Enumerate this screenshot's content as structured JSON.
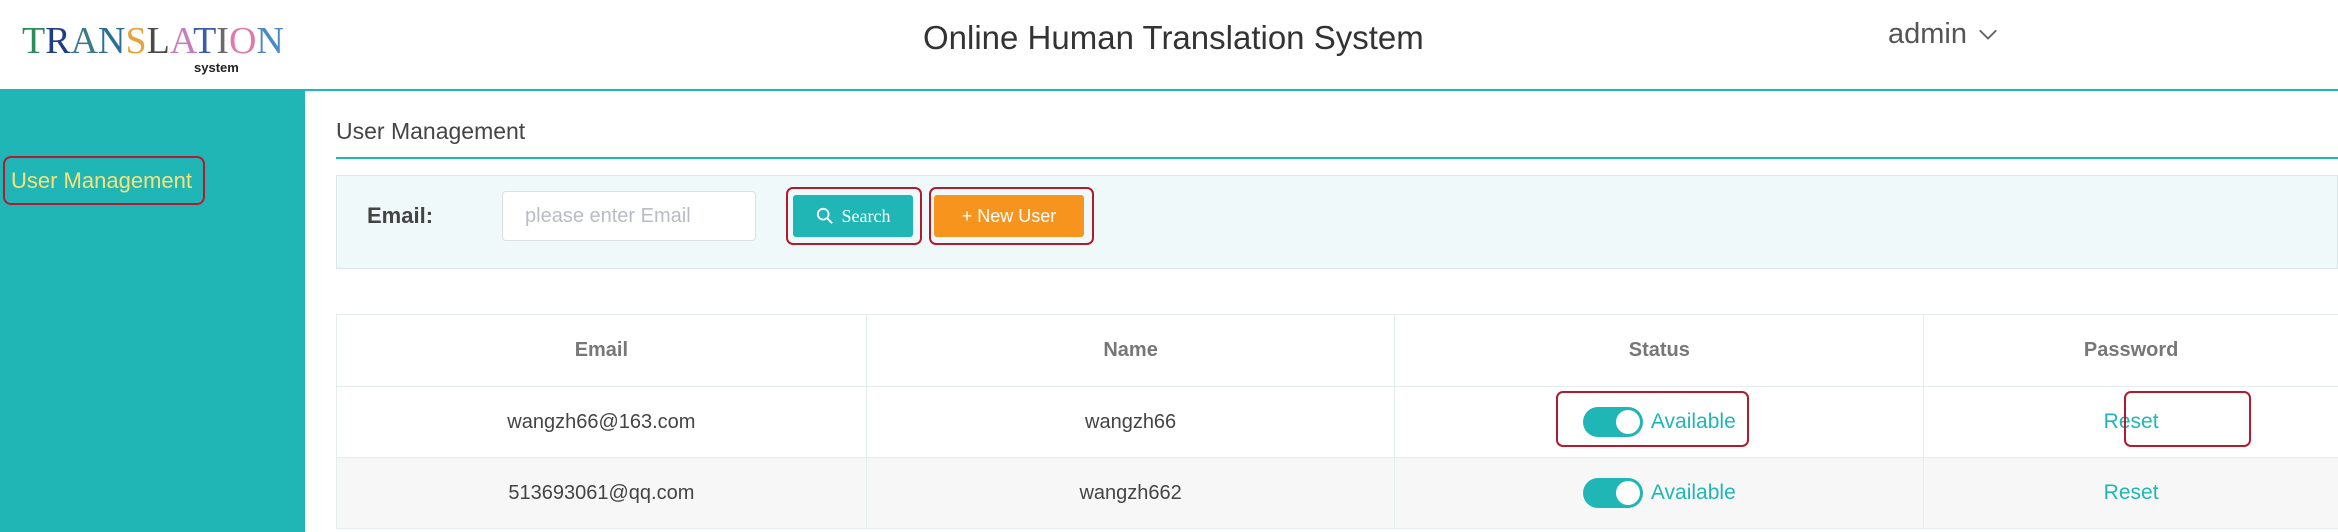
{
  "header": {
    "logo_text": "TRANSLATION",
    "logo_sub": "system",
    "app_title": "Online Human Translation System",
    "username": "admin"
  },
  "sidebar": {
    "items": [
      {
        "label": "User Management"
      }
    ]
  },
  "breadcrumb": "User Management",
  "filter": {
    "email_label": "Email:",
    "email_placeholder": "please enter Email",
    "email_value": "",
    "search_label": "Search",
    "new_user_label": "+ New User"
  },
  "table": {
    "columns": [
      "Email",
      "Name",
      "Status",
      "Password"
    ],
    "rows": [
      {
        "email": "wangzh66@163.com",
        "name": "wangzh66",
        "status": "Available",
        "password_action": "Reset"
      },
      {
        "email": "513693061@qq.com",
        "name": "wangzh662",
        "status": "Available",
        "password_action": "Reset"
      }
    ]
  },
  "colors": {
    "accent": "#21b6b6",
    "new_button": "#f7941d",
    "sidebar_text": "#f7e27a",
    "highlight_border": "#b01c2e"
  },
  "icons": [
    "search-icon",
    "plus-icon",
    "chevron-down-icon",
    "toggle-switch"
  ]
}
